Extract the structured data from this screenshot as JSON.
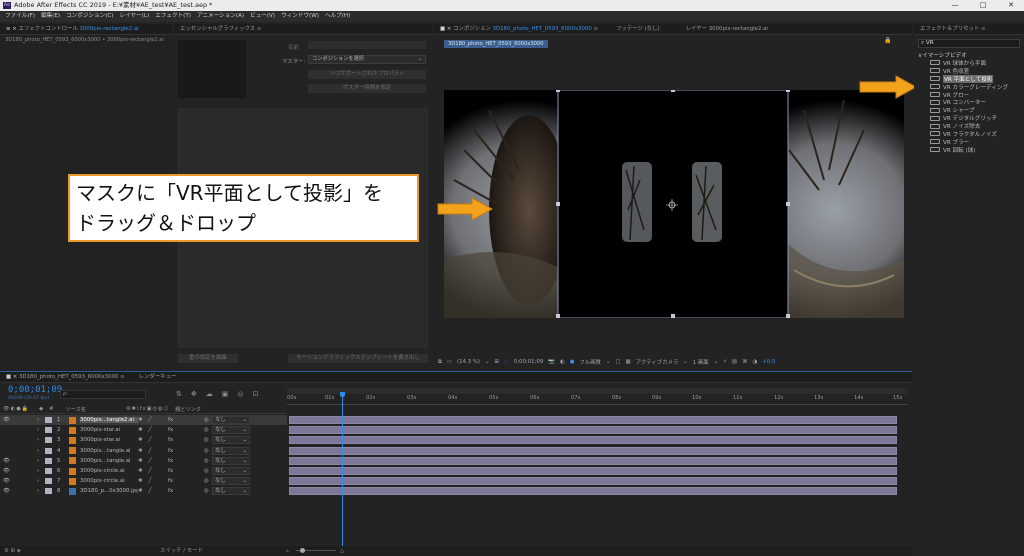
{
  "titlebar": {
    "app_icon": "Ae",
    "title": "Adobe After Effects CC 2019 - E:¥素材¥AE_test¥AE_test.aep *",
    "minimize": "—",
    "maximize": "□",
    "close": "✕"
  },
  "menu": [
    "ファイル(F)",
    "編集(E)",
    "コンポジション(C)",
    "レイヤー(L)",
    "エフェクト(T)",
    "アニメーション(A)",
    "ビュー(V)",
    "ウィンドウ(W)",
    "ヘルプ(H)"
  ],
  "effect_controls": {
    "tab_prefix": "エフェクトコントロール",
    "tab_layer": "3000pix-rectangle2.ai",
    "subtitle": "3D180_photo_HET_0593_6000x3000 • 3000pix-rectangle2.ai"
  },
  "essential_graphics": {
    "tab": "エッセンシャルグラフィックス",
    "name_label": "名前",
    "master_label": "マスター:",
    "master_value": "コンポジションを選択",
    "btn_add": "モーショングラフィックステンプレートを書き出し",
    "btn_solo": "ソロサポートされたプロパティ",
    "btn_poster": "ポスター時間を設定",
    "btn_bottom1": "重の設定を編集",
    "btn_bottom2": "モーショングラフィックステンプレートを書き出し"
  },
  "composition": {
    "tab_comp_prefix": "コンポジション",
    "tab_comp_name": "3D180_photo_HET_0593_6000x3000",
    "tab_footage": "フッテージ (なし)",
    "tab_layer": "レイヤー 3000pix-rectangle2.ai",
    "breadcrumb": "3D180_photo_HET_0593_6000x3000"
  },
  "viewer_toolbar": {
    "zoom": "(14.3 %)",
    "timecode": "0;00;01;09",
    "resolution": "フル画質",
    "camera": "アクティブカメラ",
    "views": "1 画面",
    "exposure": "+0.0"
  },
  "callout": {
    "line1": "マスクに「VR平面として投影」を",
    "line2": "ドラッグ＆ドロップ"
  },
  "effects_presets": {
    "tab": "エフェクト＆プリセット",
    "search_value": "VR",
    "category": "イマーシブビデオ",
    "items": [
      "VR 球体から平面",
      "VR 色収差",
      "VR 平面として投影",
      "VR カラーグレーディング",
      "VR グロー",
      "VR コンバーター",
      "VR シャープ",
      "VR デジタルグリッチ",
      "VR ノイズ除去",
      "VR フラクタルノイズ",
      "VR ブラー",
      "VR 回転 (球)"
    ],
    "selected_index": 2
  },
  "timeline": {
    "tab_comp": "3D180_photo_HET_0593_6000x3000",
    "tab_render": "レンダーキュー",
    "timecode": "0;00;01;09",
    "timecode_sub": "00039 (29.97 fps)",
    "search_placeholder": "ρ-",
    "col_num": "#",
    "col_source": "ソース名",
    "col_parent": "親とリンク",
    "ruler": [
      "00s",
      "01s",
      "02s",
      "03s",
      "04s",
      "05s",
      "06s",
      "07s",
      "08s",
      "09s",
      "10s",
      "11s",
      "12s",
      "13s",
      "14s",
      "15s"
    ],
    "footer": "スイッチ / モード",
    "layers": [
      {
        "num": "1",
        "name": "3000pix...tangle2.ai",
        "parent": "なし",
        "eye": true,
        "type": "ai",
        "selected": true
      },
      {
        "num": "2",
        "name": "3000pix-star.ai",
        "parent": "なし",
        "eye": false,
        "type": "ai",
        "selected": false
      },
      {
        "num": "3",
        "name": "3000pix-star.ai",
        "parent": "なし",
        "eye": false,
        "type": "ai",
        "selected": false
      },
      {
        "num": "4",
        "name": "3000pix...tangle.ai",
        "parent": "なし",
        "eye": false,
        "type": "ai",
        "selected": false
      },
      {
        "num": "5",
        "name": "3000pix...tangle.ai",
        "parent": "なし",
        "eye": true,
        "type": "ai",
        "selected": false
      },
      {
        "num": "6",
        "name": "3000pix-circle.ai",
        "parent": "なし",
        "eye": true,
        "type": "ai",
        "selected": false
      },
      {
        "num": "7",
        "name": "3000pix-circle.ai",
        "parent": "なし",
        "eye": true,
        "type": "ai",
        "selected": false
      },
      {
        "num": "8",
        "name": "3D180_p...0x3000.jpg",
        "parent": "なし",
        "eye": true,
        "type": "jpg",
        "selected": false
      }
    ]
  },
  "colors": {
    "accent_blue": "#2d8ceb",
    "callout_border": "#e89a2a",
    "arrow": "#f3a21c",
    "layer_bar": "#7c7897",
    "label_orange": "#d4791f"
  }
}
